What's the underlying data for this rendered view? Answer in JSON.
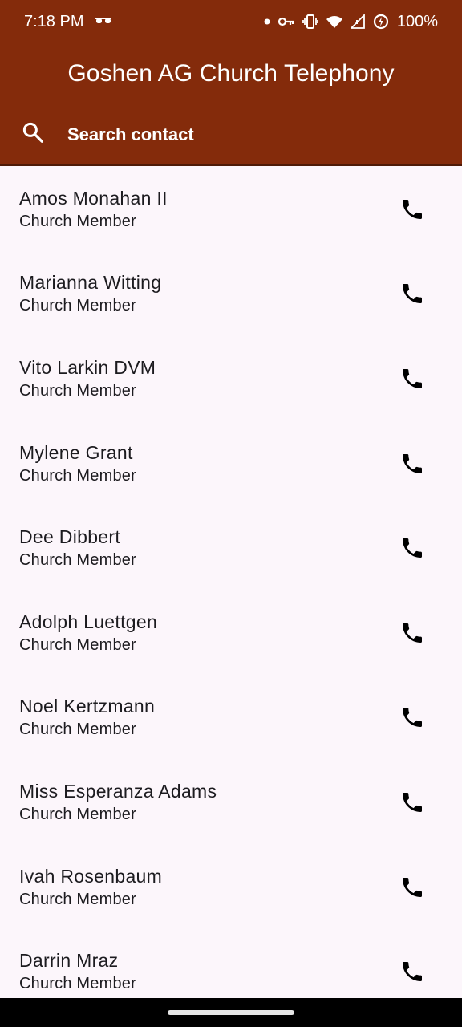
{
  "status_bar": {
    "time": "7:18 PM",
    "battery": "100%",
    "icons": [
      "glasses-icon",
      "dot-icon",
      "key-icon",
      "vibrate-icon",
      "wifi-icon",
      "signal-icon",
      "battery-saver-icon"
    ]
  },
  "app_bar": {
    "title": "Goshen AG Church Telephony"
  },
  "search": {
    "placeholder": "Search contact",
    "value": "",
    "icon": "search-icon"
  },
  "contacts": [
    {
      "name": "Amos Monahan II",
      "role": "Church Member"
    },
    {
      "name": "Marianna Witting",
      "role": "Church Member"
    },
    {
      "name": "Vito Larkin DVM",
      "role": "Church Member"
    },
    {
      "name": "Mylene Grant",
      "role": "Church Member"
    },
    {
      "name": "Dee Dibbert",
      "role": "Church Member"
    },
    {
      "name": "Adolph Luettgen",
      "role": "Church Member"
    },
    {
      "name": "Noel Kertzmann",
      "role": "Church Member"
    },
    {
      "name": "Miss Esperanza Adams",
      "role": "Church Member"
    },
    {
      "name": "Ivah Rosenbaum",
      "role": "Church Member"
    },
    {
      "name": "Darrin Mraz",
      "role": "Church Member"
    }
  ],
  "colors": {
    "primary": "#842b0b",
    "background": "#fcf6fb",
    "text": "#1c1b1f"
  }
}
